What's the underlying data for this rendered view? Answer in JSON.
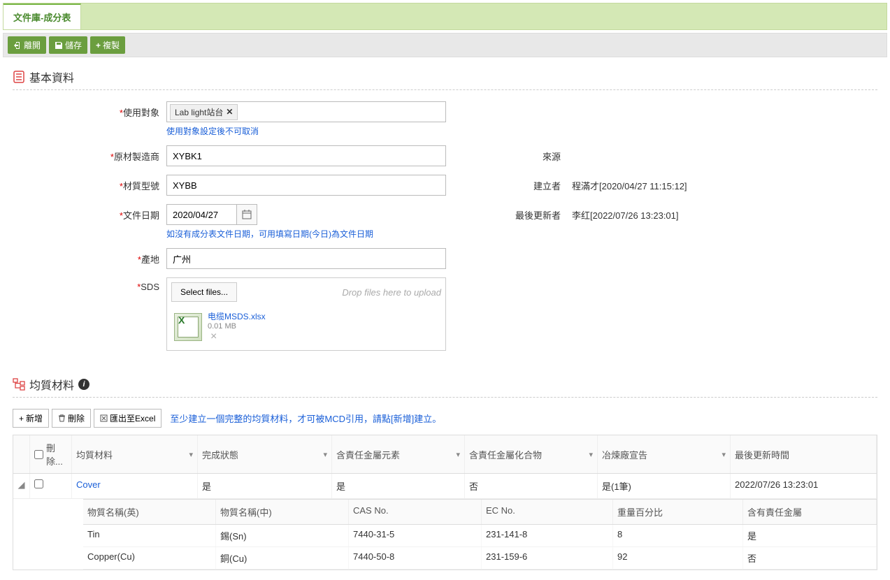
{
  "tab": {
    "title": "文件庫-成分表"
  },
  "toolbar": {
    "leave_label": "離開",
    "save_label": "儲存",
    "copy_label": "複製"
  },
  "section_basic": {
    "title": "基本資料"
  },
  "form": {
    "target_label": "使用對象",
    "target_chip": "Lab light站台",
    "target_help": "使用對象設定後不可取消",
    "manufacturer_label": "原材製造商",
    "manufacturer_value": "XYBK1",
    "model_label": "材質型號",
    "model_value": "XYBB",
    "date_label": "文件日期",
    "date_value": "2020/04/27",
    "date_help": "如沒有成分表文件日期，可用填寫日期(今日)為文件日期",
    "origin_label": "產地",
    "origin_value": "广州",
    "sds_label": "SDS",
    "select_files_label": "Select files...",
    "drop_hint": "Drop files here to upload",
    "file_name": "电缆MSDS.xlsx",
    "file_size": "0.01 MB",
    "source_label": "來源",
    "source_value": "",
    "creator_label": "建立者",
    "creator_value": "程滿才[2020/04/27 11:15:12]",
    "updater_label": "最後更新者",
    "updater_value": "李红[2022/07/26 13:23:01]"
  },
  "section_materials": {
    "title": "均質材料"
  },
  "grid_bar": {
    "add_label": "新增",
    "delete_label": "刪除",
    "export_label": "匯出至Excel",
    "hint": "至少建立一個完整的均質材料，才可被MCD引用，請點[新增]建立。"
  },
  "grid": {
    "header": {
      "delete": "刪除...",
      "material": "均質材料",
      "status": "完成狀態",
      "resp_metal": "含責任金屬元素",
      "resp_compound": "含責任金屬化合物",
      "smelter": "冶煉廠宣告",
      "updated": "最後更新時間"
    },
    "row": {
      "material": "Cover",
      "status": "是",
      "resp_metal": "是",
      "resp_compound": "否",
      "smelter": "是(1筆)",
      "updated": "2022/07/26 13:23:01"
    },
    "sub_header": {
      "name_en": "物質名稱(英)",
      "name_zh": "物質名稱(中)",
      "cas": "CAS No.",
      "ec": "EC No.",
      "weight": "重量百分比",
      "responsible": "含有責任金屬"
    },
    "sub_rows": [
      {
        "en": "Tin",
        "zh": "錫(Sn)",
        "cas": "7440-31-5",
        "ec": "231-141-8",
        "weight": "8",
        "resp": "是"
      },
      {
        "en": "Copper(Cu)",
        "zh": "銅(Cu)",
        "cas": "7440-50-8",
        "ec": "231-159-6",
        "weight": "92",
        "resp": "否"
      }
    ]
  }
}
